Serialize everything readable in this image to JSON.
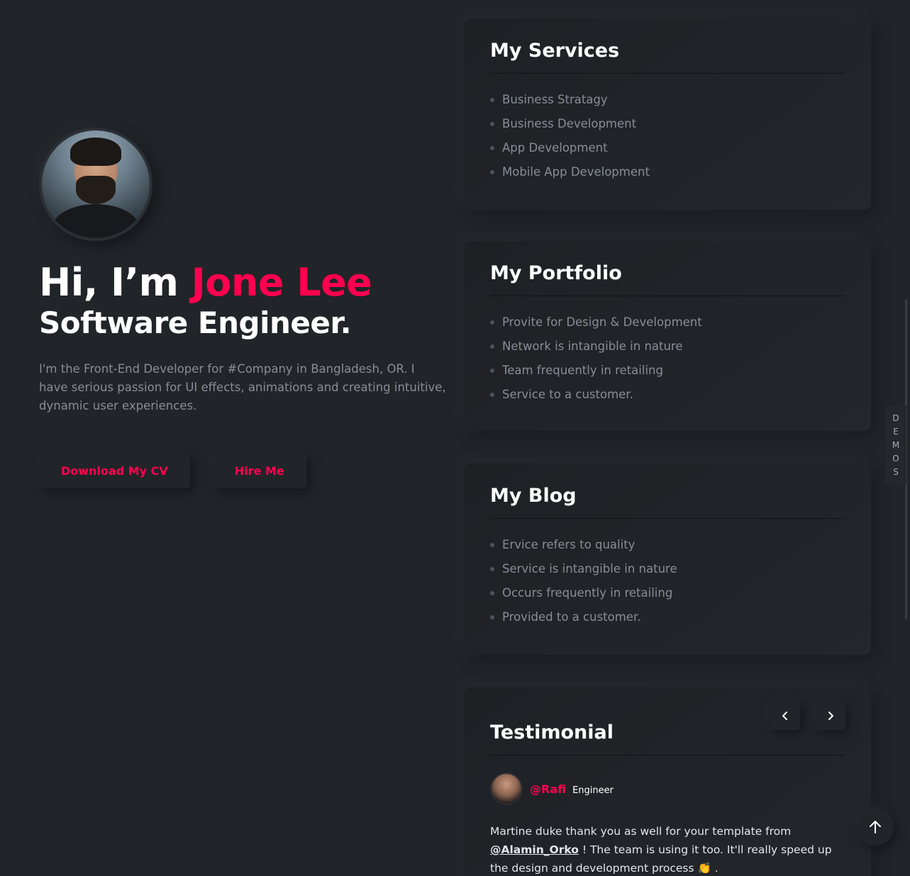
{
  "hero": {
    "greeting": "Hi, I’m ",
    "name": "Jone Lee",
    "role": "Software Engineer.",
    "description": "I'm the Front-End Developer for #Company in Bangladesh, OR. I have serious passion for UI effects, animations and creating intuitive, dynamic user experiences.",
    "download_cv_label": "Download My CV",
    "hire_me_label": "Hire Me"
  },
  "services": {
    "title": "My Services",
    "items": [
      "Business Stratagy",
      "Business Development",
      "App Development",
      "Mobile App Development"
    ]
  },
  "portfolio": {
    "title": "My Portfolio",
    "items": [
      "Provite for Design & Development",
      "Network is intangible in nature",
      "Team frequently in retailing",
      "Service to a customer."
    ]
  },
  "blog": {
    "title": "My Blog",
    "items": [
      "Ervice refers to quality",
      "Service is intangible in nature",
      "Occurs frequently in retailing",
      "Provided to a customer."
    ]
  },
  "testimonial": {
    "title": "Testimonial",
    "author_handle": "@Rafi",
    "author_role": "Engineer",
    "text_before": "Martine duke thank you as well for your template from ",
    "mention": "@Alamin_Orko",
    "text_after": " ! The team is using it too. It'll really speed up the design and development process 👏 ."
  },
  "sidebar": {
    "demos_letters": [
      "D",
      "E",
      "M",
      "O",
      "S"
    ]
  },
  "colors": {
    "accent": "#ff014f",
    "background": "#212428",
    "muted_text": "#878e99"
  },
  "icons": {
    "prev": "chevron-left-icon",
    "next": "chevron-right-icon",
    "back_to_top": "arrow-up-icon"
  }
}
